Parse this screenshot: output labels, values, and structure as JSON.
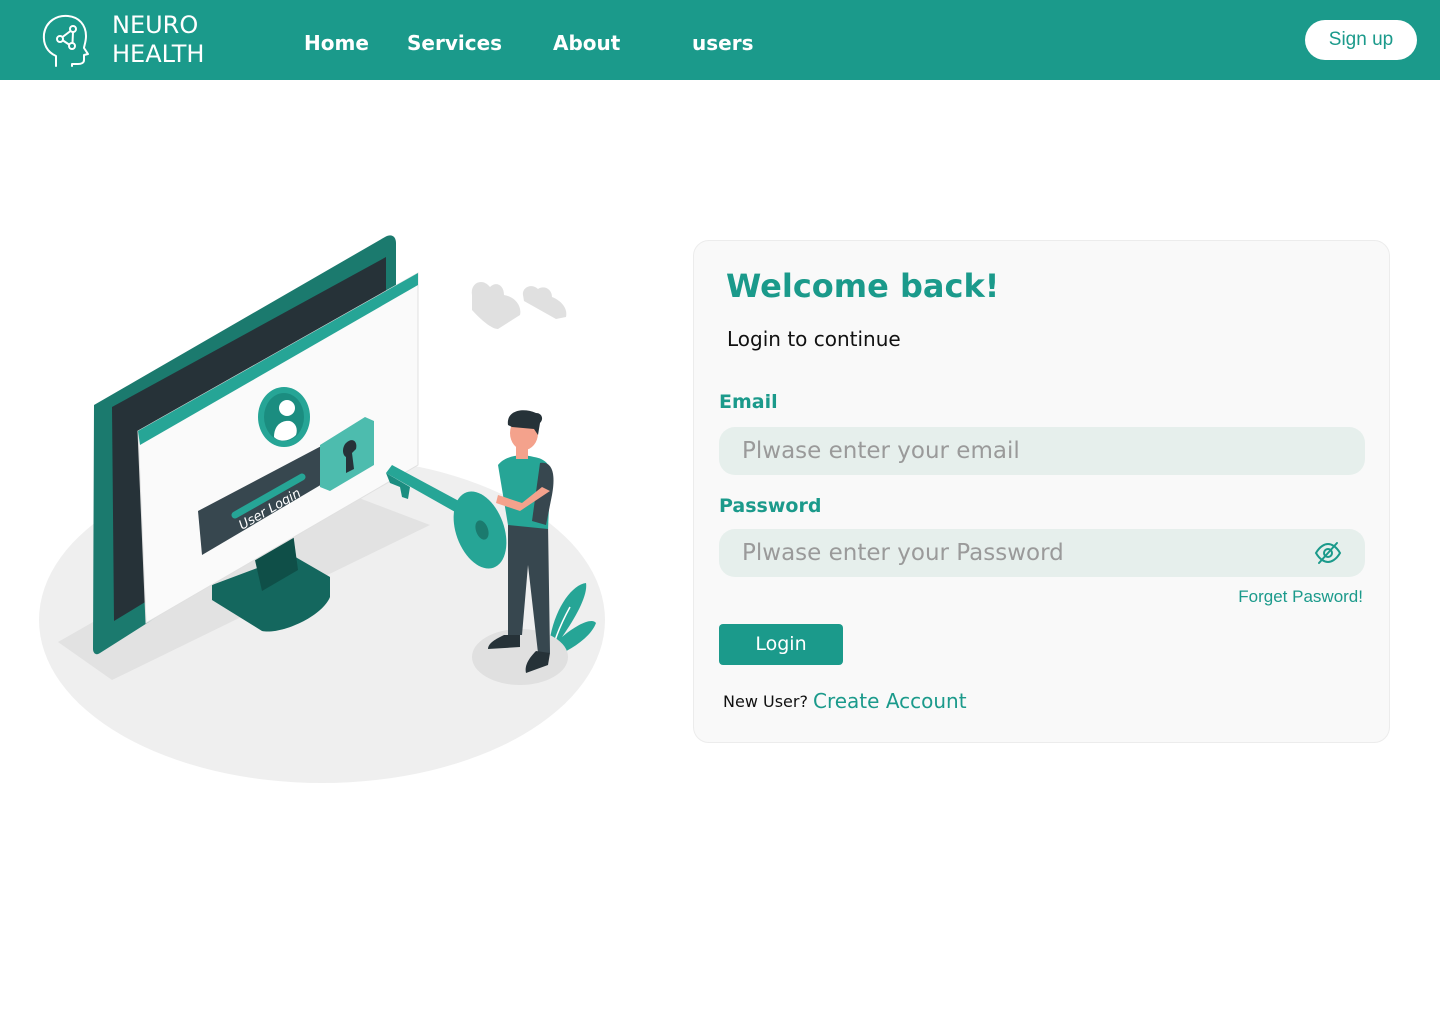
{
  "colors": {
    "brand": "#1b9a8b",
    "input_bg": "#e6efec",
    "card_bg": "#f9f9f9"
  },
  "header": {
    "brand_line1": "NEURO",
    "brand_line2": "HEALTH",
    "logo_icon": "brain-network-head-icon",
    "nav": [
      {
        "label": "Home"
      },
      {
        "label": "Services"
      },
      {
        "label": "About"
      },
      {
        "label": "users"
      }
    ],
    "signup_label": "Sign up"
  },
  "illustration": {
    "screen_label": "User Login"
  },
  "login": {
    "title": "Welcome back!",
    "subtitle": "Login to continue",
    "email_label": "Email",
    "email_placeholder": "Plwase enter your email",
    "password_label": "Password",
    "password_placeholder": "Plwase enter your Password",
    "password_toggle_icon": "eye-slash-icon",
    "forgot_label": "Forget Pasword!",
    "login_label": "Login",
    "new_user_text": "New User?",
    "create_account_label": "Create Account"
  }
}
